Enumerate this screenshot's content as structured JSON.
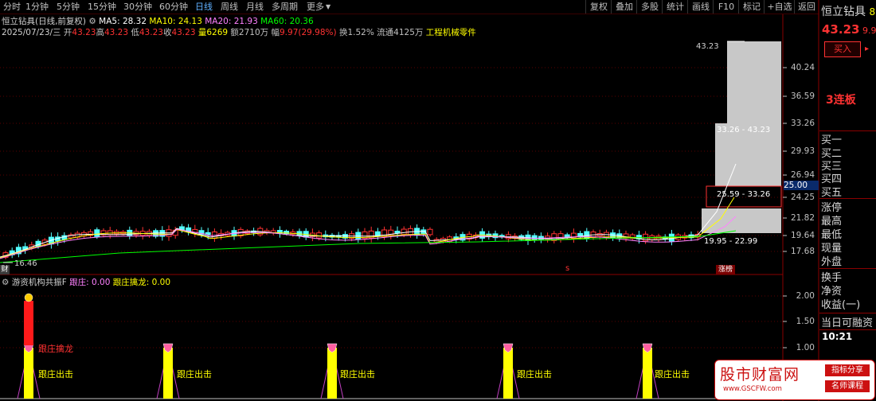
{
  "toolbar": {
    "periods": [
      "分时",
      "1分钟",
      "5分钟",
      "15分钟",
      "30分钟",
      "60分钟",
      "日线",
      "周线",
      "月线",
      "多周期",
      "更多"
    ],
    "active_period": "日线",
    "right_buttons": [
      "复权",
      "叠加",
      "多股",
      "统计",
      "画线",
      "F10",
      "标记",
      "+自选",
      "返回"
    ]
  },
  "header": {
    "stock_name": "恒立钻具",
    "mode": "(日线,前复权)",
    "ma5": "MA5: 28.32",
    "ma10": "MA10: 24.13",
    "ma20": "MA20: 21.93",
    "ma60": "MA60: 20.36",
    "date": "2025/07/23/三",
    "open_label": "开",
    "open": "43.23",
    "high_label": "高",
    "high": "43.23",
    "low_label": "低",
    "low": "43.23",
    "close_label": "收",
    "close": "43.23",
    "vol_label": "量",
    "vol": "6269",
    "amt_label": "额",
    "amt": "2710万",
    "chg_label": "幅",
    "chg": "9.97(29.98%)",
    "turnover": "换1.52%",
    "float": "流通4125万",
    "industry": "工程机械零件"
  },
  "price_axis": [
    "40.24",
    "36.59",
    "33.26",
    "29.93",
    "26.94",
    "24.25",
    "21.82",
    "19.64",
    "17.68"
  ],
  "price_highlight": "25.00",
  "annotations": {
    "top_price": "43.23",
    "range1": "33.26 - 43.23",
    "range2": "25.59 - 33.26",
    "range3": "19.95 - 22.99",
    "low_price": "16.46",
    "badge_cai": "财",
    "badge_s": "s",
    "badge_zhangbang": "涨榜"
  },
  "indicator": {
    "name": "游资机构共振F",
    "v1_label": "跟庄: 0.00",
    "v2_label": "跟庄擒龙: 0.00",
    "axis": [
      "2.00",
      "1.50",
      "1.00"
    ],
    "signal_qinlong": "跟庄擒龙",
    "signal_chuji": "跟庄出击"
  },
  "right_panel": {
    "name": "恒立钻具",
    "code_part": "8",
    "price": "43.23",
    "chg_part": "9.9",
    "buy_button": "买入",
    "streak": "3连板",
    "items": [
      "买一",
      "买二",
      "买三",
      "买四",
      "买五",
      "涨停",
      "最高",
      "最低",
      "现量",
      "外盘",
      "换手",
      "净资",
      "收益(一)",
      "当日可融资"
    ],
    "time": "10:21"
  },
  "watermark": {
    "title": "股市财富网",
    "url": "www.GSCFW.com",
    "tag1": "指标分享",
    "tag2": "名师课程"
  },
  "colors": {
    "up": "#ff3232",
    "down": "#54ffff",
    "ma5": "#ffffff",
    "ma10": "#ffff00",
    "ma20": "#ff80ff",
    "ma60": "#00ff00",
    "accent": "#5fb0ff",
    "signal": "#ffff00"
  }
}
